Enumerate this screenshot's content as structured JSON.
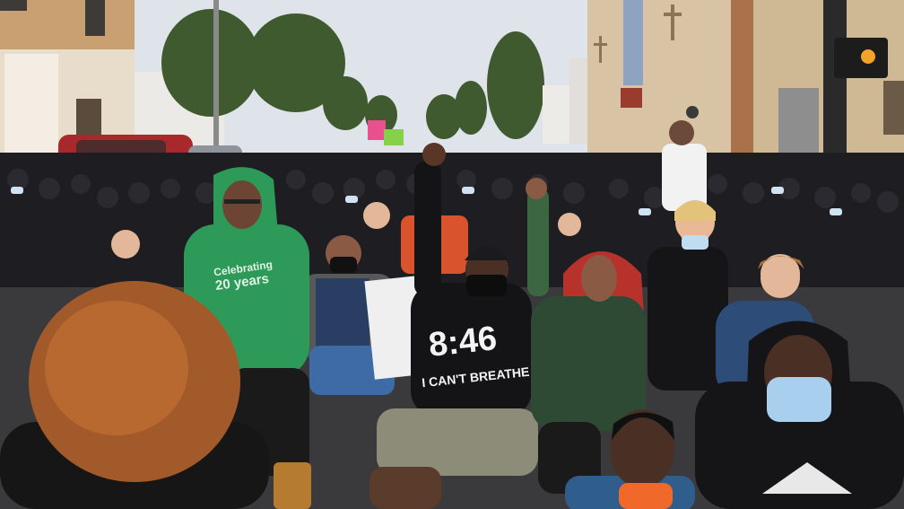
{
  "image": {
    "kind": "photograph",
    "scene_texts": {
      "green_hoodie_line1": "Celebrating",
      "green_hoodie_line2": "20 years",
      "black_shirt_line1": "8:46",
      "black_shirt_line2": "I CAN'T BREATHE"
    }
  },
  "colors": {
    "sky": "#dfe4ea",
    "street": "#3a3a3c",
    "brick_left": "#c9a072",
    "brick_right": "#d8c4a4",
    "green_hoodie": "#2e9a5a",
    "red_hair": "#b8322c",
    "orange_mask": "#f0692a",
    "blue_mask": "#a9cfee"
  }
}
